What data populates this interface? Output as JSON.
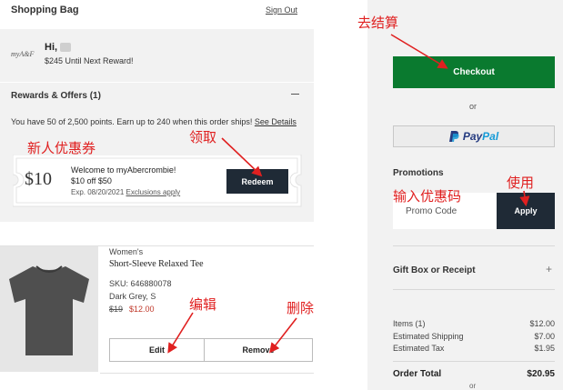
{
  "header": {
    "title": "Shopping Bag",
    "sign_out": "Sign Out"
  },
  "rewards_summary": {
    "logo": "myA&F",
    "greeting": "Hi,",
    "next_reward": "$245 Until Next Reward!"
  },
  "rewards_offers": {
    "title": "Rewards & Offers (1)",
    "points_text": "You have 50 of 2,500 points. Earn up to 240 when this order ships!",
    "see_details": "See Details",
    "coupon": {
      "amount": "$10",
      "welcome": "Welcome to myAbercrombie!",
      "offer": "$10 off $50",
      "expiry": "Exp. 08/20/2021",
      "exclusions": "Exclusions apply",
      "redeem_label": "Redeem"
    }
  },
  "product": {
    "category": "Women's",
    "name": "Short-Sleeve Relaxed Tee",
    "sku": "SKU: 646880078",
    "color_size": "Dark Grey, S",
    "price_original": "$19",
    "price_sale": "$12.00",
    "edit_label": "Edit",
    "remove_label": "Remove"
  },
  "checkout": {
    "checkout_label": "Checkout",
    "or_label": "or",
    "paypal_pay": "Pay",
    "paypal_pal": "Pal",
    "promotions_title": "Promotions",
    "promo_placeholder": "Promo Code",
    "apply_label": "Apply",
    "gift_title": "Gift Box or Receipt",
    "gift_toggle": "+",
    "summary": [
      {
        "label": "Items (1)",
        "value": "$12.00"
      },
      {
        "label": "Estimated Shipping",
        "value": "$7.00"
      },
      {
        "label": "Estimated Tax",
        "value": "$1.95"
      }
    ],
    "order_total_label": "Order Total",
    "order_total_value": "$20.95",
    "or_bottom": "or"
  },
  "annotations": {
    "checkout_note": "去结算",
    "coupon_note": "新人优惠券",
    "claim_note": "领取",
    "promo_note": "输入优惠码",
    "use_note": "使用",
    "edit_note": "编辑",
    "delete_note": "删除",
    "color": "#e02020"
  },
  "colors": {
    "checkout_green": "#0a7a2f",
    "dark_button": "#1f2a36",
    "sale_red": "#c0392b",
    "panel_grey": "#f2f2f2"
  }
}
